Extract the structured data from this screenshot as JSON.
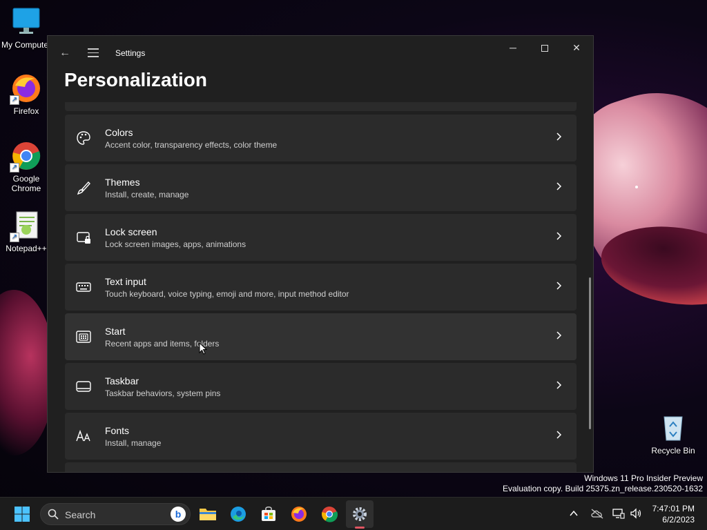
{
  "desktop": {
    "icons": [
      {
        "label": "My Computer"
      },
      {
        "label": "Firefox"
      },
      {
        "label": "Google Chrome"
      },
      {
        "label": "Notepad++"
      },
      {
        "label": "Recycle Bin"
      }
    ]
  },
  "window": {
    "title": "Settings",
    "page_title": "Personalization",
    "controls": {
      "minimize": "─",
      "close": "✕",
      "back": "←"
    }
  },
  "settings_items": [
    {
      "title": "Colors",
      "subtitle": "Accent color, transparency effects, color theme",
      "icon": "palette-icon"
    },
    {
      "title": "Themes",
      "subtitle": "Install, create, manage",
      "icon": "brush-icon"
    },
    {
      "title": "Lock screen",
      "subtitle": "Lock screen images, apps, animations",
      "icon": "lock-screen-icon"
    },
    {
      "title": "Text input",
      "subtitle": "Touch keyboard, voice typing, emoji and more, input method editor",
      "icon": "keyboard-icon"
    },
    {
      "title": "Start",
      "subtitle": "Recent apps and items, folders",
      "icon": "start-menu-icon"
    },
    {
      "title": "Taskbar",
      "subtitle": "Taskbar behaviors, system pins",
      "icon": "taskbar-icon"
    },
    {
      "title": "Fonts",
      "subtitle": "Install, manage",
      "icon": "fonts-icon"
    }
  ],
  "watermark": {
    "line1": "Windows 11 Pro Insider Preview",
    "line2": "Evaluation copy. Build 25375.zn_release.230520-1632"
  },
  "taskbar": {
    "search_label": "Search",
    "bing_label": "b",
    "apps": [
      "start-icon",
      "file-explorer-icon",
      "edge-icon",
      "store-icon",
      "firefox-icon",
      "chrome-icon",
      "settings-icon"
    ],
    "active_app": "settings-icon",
    "clock": {
      "time": "7:47:01 PM",
      "date": "6/2/2023"
    }
  },
  "colors": {
    "window_bg": "#202020",
    "card_bg": "#2b2b2b",
    "active_indicator": "#e05562"
  }
}
